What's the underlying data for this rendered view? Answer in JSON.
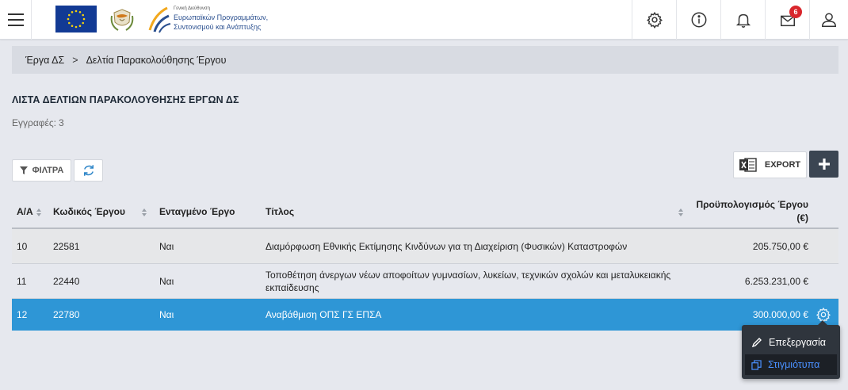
{
  "header": {
    "org_line1": "Γενική Διεύθυνση",
    "org_line2": "Ευρωπαϊκών Προγραμμάτων,",
    "org_line3": "Συντονισμού και Ανάπτυξης",
    "notification_count": "6",
    "icons": [
      "menu-icon",
      "settings-gear-icon",
      "info-icon",
      "bell-icon",
      "envelope-icon",
      "user-icon"
    ]
  },
  "breadcrumb": {
    "items": [
      "Έργα ΔΣ",
      "Δελτία Παρακολούθησης Έργου"
    ],
    "separator": ">"
  },
  "page": {
    "title": "ΛΙΣΤΑ ΔΕΛΤΙΩΝ ΠΑΡΑΚΟΛΟΥΘΗΣΗΣ ΕΡΓΩΝ ΔΣ",
    "records_label": "Εγγραφές:",
    "records_count": "3"
  },
  "toolbar": {
    "filter_label": "ΦΙΛΤΡΑ",
    "export_label": "EXPORT"
  },
  "table": {
    "headers": {
      "aa": "Α/Α",
      "code": "Κωδικός Έργου",
      "integrated": "Ενταγμένο Έργο",
      "title": "Τίτλος",
      "budget_line1": "Προϋπολογισμός Έργου",
      "budget_line2": "(€)"
    },
    "rows": [
      {
        "aa": "10",
        "code": "22581",
        "integrated": "Ναι",
        "title": "Διαμόρφωση Εθνικής Εκτίμησης Κινδύνων για τη Διαχείριση (Φυσικών) Καταστροφών",
        "budget": "205.750,00 €"
      },
      {
        "aa": "11",
        "code": "22440",
        "integrated": "Ναι",
        "title": "Τοποθέτηση άνεργων νέων αποφοίτων γυμνασίων, λυκείων, τεχνικών σχολών και μεταλυκειακής εκπαίδευσης",
        "budget": "6.253.231,00 €"
      },
      {
        "aa": "12",
        "code": "22780",
        "integrated": "Ναι",
        "title": "Αναβάθμιση ΟΠΣ ΓΣ ΕΠΣΑ",
        "budget": "300.000,00 €"
      }
    ],
    "selected_row": 2
  },
  "context_menu": {
    "items": [
      "Επεξεργασία",
      "Στιγμιότυπα"
    ],
    "active_index": 1
  },
  "colors": {
    "selected_row": "#2e96d6",
    "menu_bg": "#2f353d",
    "badge": "#d9262c",
    "add_button": "#3b4552"
  }
}
